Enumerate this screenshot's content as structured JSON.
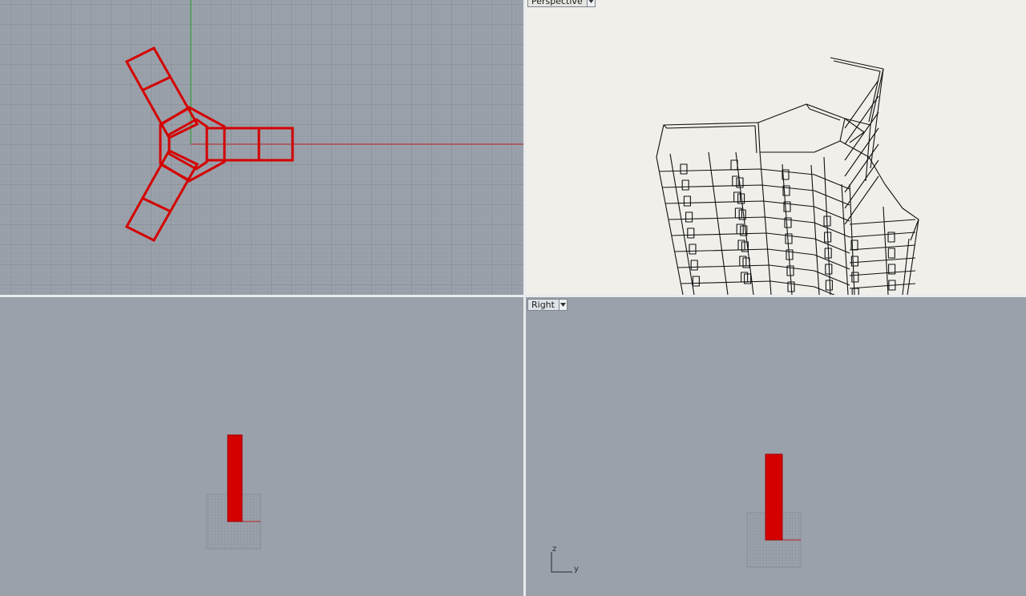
{
  "viewports": {
    "top": {
      "label": ""
    },
    "perspective": {
      "label": "Perspective"
    },
    "front": {
      "label": ""
    },
    "right": {
      "label": "Right"
    }
  },
  "axis_widget": {
    "z_label": "z",
    "y_label": "y"
  },
  "colors": {
    "viewport_bg": "#9aa1aa",
    "perspective_bg": "#f0efea",
    "selected_geometry": "#d40000",
    "x_axis": "#b82020",
    "y_axis": "#1f9a1f",
    "grid_minor": "#8d949d",
    "grid_major": "#7e858e",
    "wire": "#111111"
  },
  "icons": {
    "viewport_menu": "triangle-down-icon"
  }
}
